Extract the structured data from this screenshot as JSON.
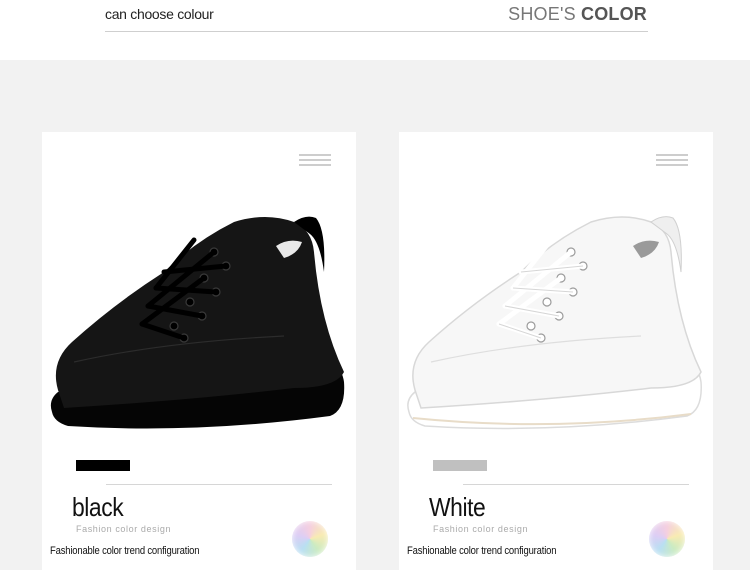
{
  "header": {
    "left_text": "can choose colour",
    "right_text_light": "SHOE'S ",
    "right_text_bold": "COLOR"
  },
  "cards": [
    {
      "color_name": "black",
      "subtitle": "Fashion color design",
      "caption": "Fashionable color trend configuration",
      "swatch_color": "#000000",
      "shoe_color": "#111111"
    },
    {
      "color_name": "White",
      "subtitle": "Fashion color design",
      "caption": "Fashionable color trend configuration",
      "swatch_color": "#c0c0c0",
      "shoe_color": "#f8f8f8"
    }
  ],
  "icons": {
    "menu": "menu-lines-icon",
    "badge": "holographic-badge-icon"
  }
}
